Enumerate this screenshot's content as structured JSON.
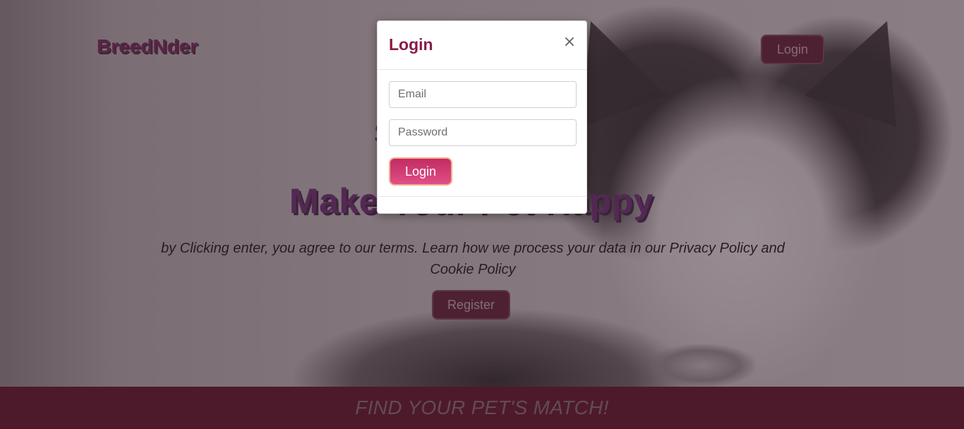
{
  "app": {
    "brand": "BreedNder",
    "nav_login_label": "Login"
  },
  "hero": {
    "subtitle": "S",
    "title": "Make Your Pet Happy",
    "terms": "by Clicking enter, you agree to our terms. Learn how we process your data in our Privacy Policy and Cookie Policy",
    "register_label": "Register"
  },
  "footer": {
    "text": "FIND YOUR PET'S MATCH!"
  },
  "modal": {
    "title": "Login",
    "close_glyph": "×",
    "email_placeholder": "Email",
    "email_value": "",
    "password_placeholder": "Password",
    "password_value": "",
    "submit_label": "Login"
  },
  "colors": {
    "brand": "#7a1f5a",
    "footer_bg": "#5f0d24",
    "modal_title": "#8b1a4a",
    "modal_button": "#d1386f",
    "modal_button_border": "#f4b08b"
  }
}
